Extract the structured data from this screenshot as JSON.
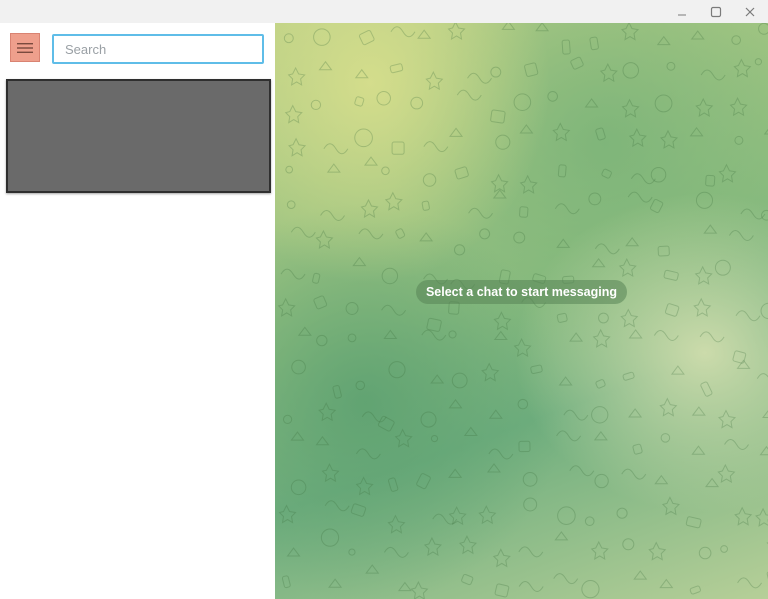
{
  "window_controls": {
    "minimize_icon": "minimize-icon",
    "maximize_icon": "maximize-icon",
    "close_icon": "close-icon"
  },
  "sidebar": {
    "menu_icon": "hamburger-menu-icon",
    "search": {
      "placeholder": "Search",
      "value": ""
    },
    "accent_color": "#ee9f8c",
    "search_border_color": "#5fbde8"
  },
  "chat_area": {
    "empty_message": "Select a chat to start messaging"
  }
}
